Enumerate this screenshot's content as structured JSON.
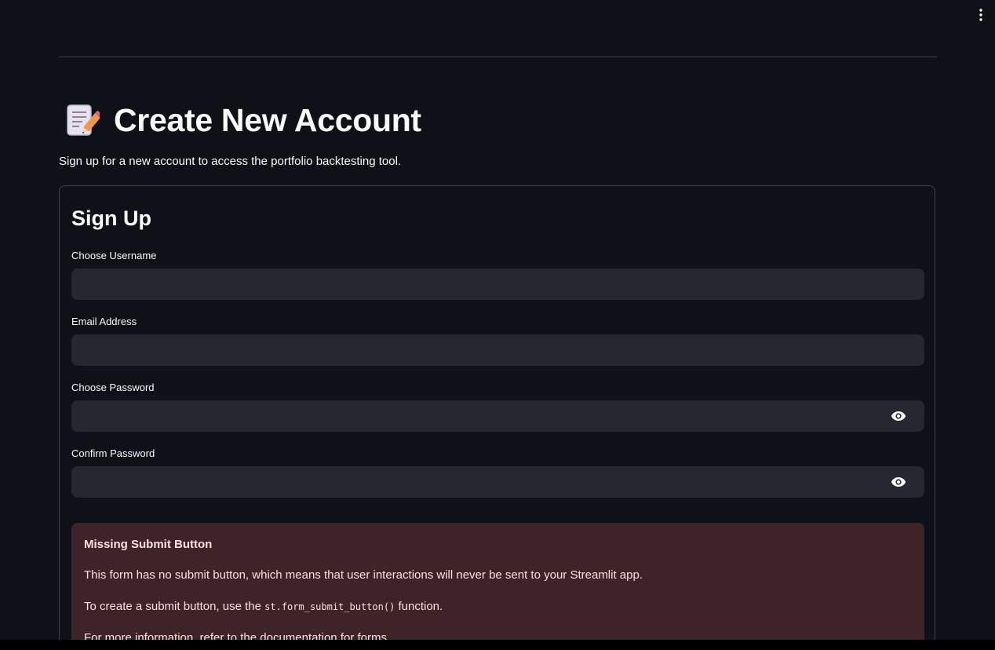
{
  "header": {
    "title": "Create New Account",
    "emoji_icon": "memo-icon",
    "subtitle": "Sign up for a new account to access the portfolio backtesting tool."
  },
  "form": {
    "title": "Sign Up",
    "fields": [
      {
        "label": "Choose Username",
        "value": "",
        "type": "text"
      },
      {
        "label": "Email Address",
        "value": "",
        "type": "text"
      },
      {
        "label": "Choose Password",
        "value": "",
        "type": "password",
        "toggle_icon": "eye-icon"
      },
      {
        "label": "Confirm Password",
        "value": "",
        "type": "password",
        "toggle_icon": "eye-icon"
      }
    ]
  },
  "alert": {
    "title": "Missing Submit Button",
    "line1": "This form has no submit button, which means that user interactions will never be sent to your Streamlit app.",
    "line2_prefix": "To create a submit button, use the",
    "line2_code": "st.form_submit_button()",
    "line2_suffix": "function.",
    "line3": "For more information, refer to the documentation for forms."
  },
  "colors": {
    "background": "#0e1117",
    "input_bg": "#262730",
    "alert_bg": "#3e2428",
    "alert_text": "#ffdede",
    "border": "#3d4047"
  },
  "menu_icon": "kebab-menu-icon"
}
